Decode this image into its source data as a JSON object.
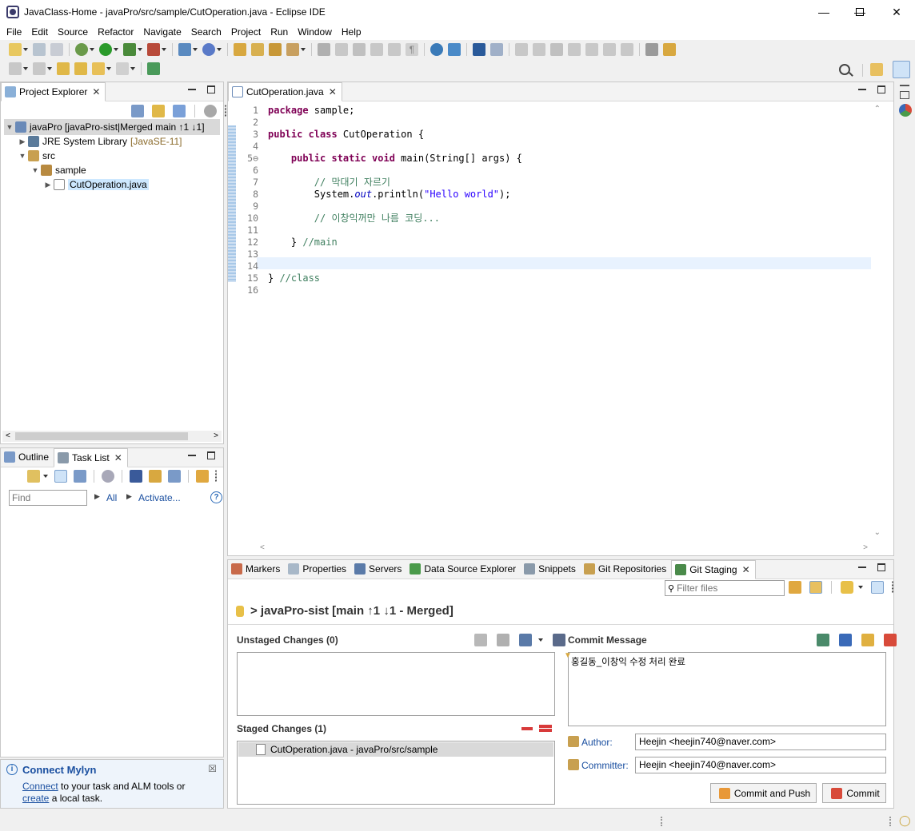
{
  "window": {
    "title": "JavaClass-Home - javaPro/src/sample/CutOperation.java - Eclipse IDE"
  },
  "menu": [
    "File",
    "Edit",
    "Source",
    "Refactor",
    "Navigate",
    "Search",
    "Project",
    "Run",
    "Window",
    "Help"
  ],
  "project_explorer": {
    "tab_label": "Project Explorer",
    "tree": [
      {
        "label": "javaPro [javaPro-sist|Merged main ↑1 ↓1]",
        "depth": 0,
        "expanded": true
      },
      {
        "label": "JRE System Library",
        "suffix": "[JavaSE-11]",
        "depth": 1,
        "expanded": false
      },
      {
        "label": "src",
        "depth": 1,
        "expanded": true
      },
      {
        "label": "sample",
        "depth": 2,
        "expanded": true
      },
      {
        "label": "CutOperation.java",
        "depth": 3,
        "expanded": false
      }
    ]
  },
  "outline": {
    "tab_outline": "Outline",
    "tab_tasklist": "Task List",
    "find_placeholder": "Find",
    "all_label": "All",
    "activate_label": "Activate..."
  },
  "mylyn": {
    "title": "Connect Mylyn",
    "line1_link": "Connect",
    "line1_rest": " to your task and ALM tools or",
    "line2_link": "create",
    "line2_rest": " a local task."
  },
  "editor": {
    "tab_label": "CutOperation.java",
    "lines": [
      {
        "n": "1",
        "html": "<span class='kw'>package</span> sample;"
      },
      {
        "n": "2",
        "html": ""
      },
      {
        "n": "3",
        "html": "<span class='kw'>public class</span> CutOperation {"
      },
      {
        "n": "4",
        "html": ""
      },
      {
        "n": "5⊖",
        "html": "    <span class='kw'>public static void</span> main(String[] args) {"
      },
      {
        "n": "6",
        "html": ""
      },
      {
        "n": "7",
        "html": "        <span class='com'>// 막대기 자르기</span>"
      },
      {
        "n": "8",
        "html": "        System.<span class='fld'>out</span>.println(<span class='str'>\"Hello world\"</span>);"
      },
      {
        "n": "9",
        "html": ""
      },
      {
        "n": "10",
        "html": "        <span class='com'>// 이창익꺼만 나름 코딩...</span>"
      },
      {
        "n": "11",
        "html": ""
      },
      {
        "n": "12",
        "html": "    } <span class='com'>//main</span>"
      },
      {
        "n": "13",
        "html": ""
      },
      {
        "n": "14",
        "html": ""
      },
      {
        "n": "15",
        "html": "} <span class='com'>//class</span>"
      },
      {
        "n": "16",
        "html": ""
      }
    ]
  },
  "bottom_tabs": [
    "Markers",
    "Properties",
    "Servers",
    "Data Source Explorer",
    "Snippets",
    "Git Repositories",
    "Git Staging"
  ],
  "git_staging": {
    "filter_placeholder": "Filter files",
    "repo_title": "> javaPro-sist [main ↑1 ↓1 - Merged]",
    "unstaged_title": "Unstaged Changes (0)",
    "staged_title": "Staged Changes (1)",
    "staged_files": [
      "CutOperation.java - javaPro/src/sample"
    ],
    "commit_message_title": "Commit Message",
    "commit_message": "홍길동_이창익 수정 처리 완료",
    "author_label": "Author:",
    "author_value": "Heejin <heejin740@naver.com>",
    "committer_label": "Committer:",
    "committer_value": "Heejin <heejin740@naver.com>",
    "commit_push_label": "Commit and Push",
    "commit_label": "Commit"
  },
  "colors": {
    "accent_blue": "#1a4fa0",
    "keyword": "#7f0055",
    "string": "#2a00ff",
    "comment": "#3f7f5f",
    "field": "#0000c0",
    "current_line": "#e8f2fe"
  }
}
